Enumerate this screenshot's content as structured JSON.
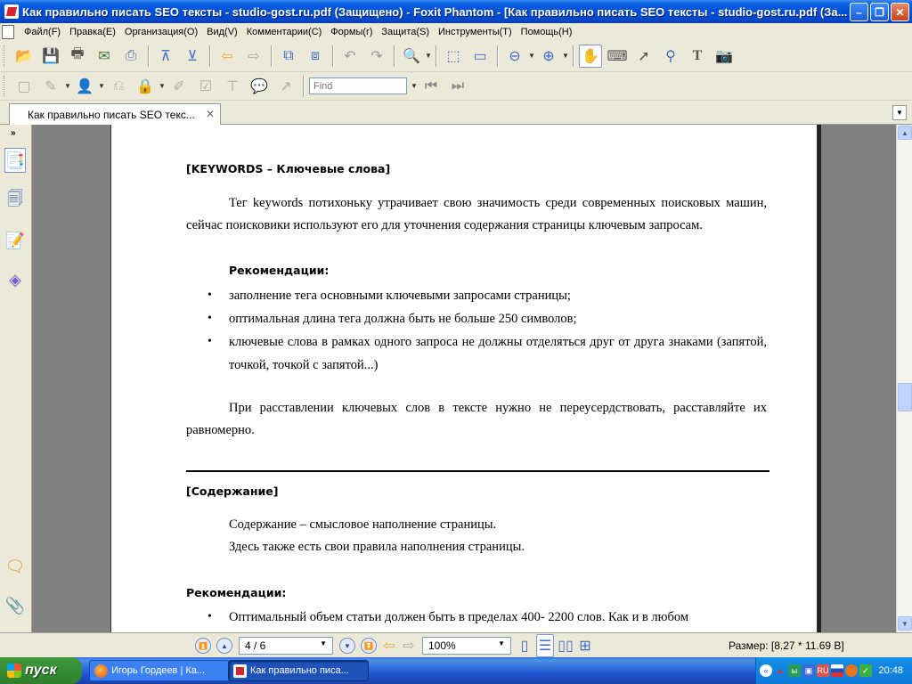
{
  "window": {
    "title": "Как правильно писать SEO тексты - studio-gost.ru.pdf (Защищено) - Foxit Phantom - [Как правильно писать SEO тексты - studio-gost.ru.pdf (За..."
  },
  "menu": [
    "Файл(F)",
    "Правка(E)",
    "Организация(O)",
    "Вид(V)",
    "Комментарии(C)",
    "Формы(r)",
    "Защита(S)",
    "Инструменты(T)",
    "Помощь(H)"
  ],
  "toolbar": {
    "find_placeholder": "Find"
  },
  "tab": {
    "label": "Как правильно писать SEO текс..."
  },
  "document": {
    "heading1": "[KEYWORDS – Ключевые слова]",
    "para1": "Тег keywords потихоньку утрачивает свою значимость среди современных поисковых машин, сейчас поисковики используют его для уточнения содержания страницы ключевым запросам.",
    "rec_label": "Рекомендации:",
    "bullets1": [
      "заполнение тега основными ключевыми запросами страницы;",
      "оптимальная длина тега должна быть не больше 250 символов;",
      "ключевые слова в рамках одного запроса не должны отделяться друг от друга знаками (запятой, точкой, точкой с запятой...)"
    ],
    "para2": "При расставлении ключевых слов в тексте нужно не переусердствовать, расставляйте их равномерно.",
    "heading2": "[Содержание]",
    "line1": "Содержание – смысловое наполнение страницы.",
    "line2": "Здесь также есть свои правила наполнения страницы.",
    "rec_label2": "Рекомендации:",
    "bullets2": [
      "Оптимальный объем статьи должен быть  в пределах 400- 2200 слов. Как и в любом"
    ]
  },
  "status": {
    "page_indicator": "4 / 6",
    "zoom": "100%",
    "size": "Размер: [8.27 * 11.69 В]"
  },
  "taskbar": {
    "start": "пуск",
    "tasks": [
      "Игорь Гордеев | Ка...",
      "Как правильно писа..."
    ],
    "clock": "20:48"
  }
}
